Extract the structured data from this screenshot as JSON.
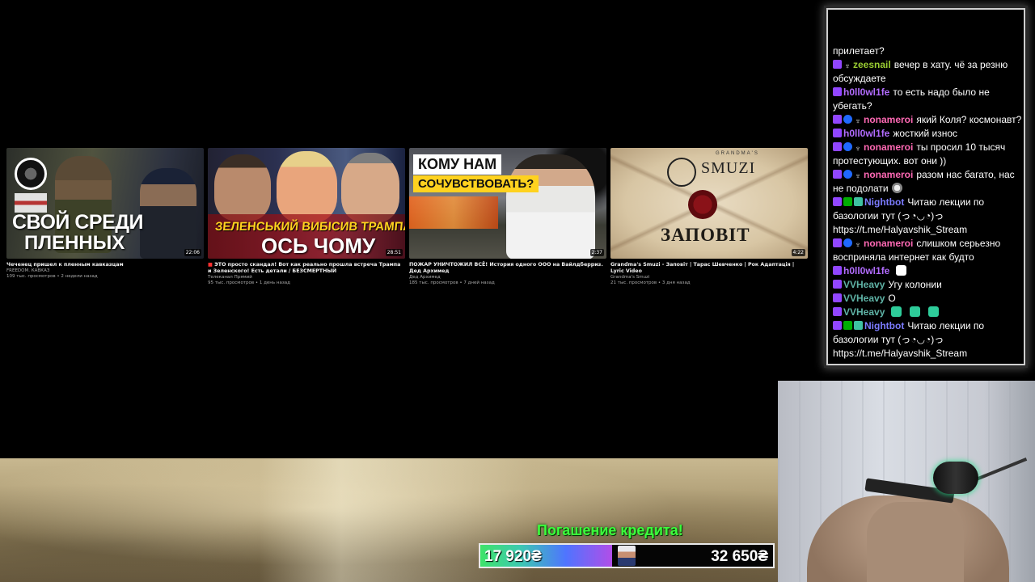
{
  "videos": [
    {
      "thumb_title_line1": "СВОЙ СРЕДИ",
      "thumb_title_line2": "ПЛЕННЫХ",
      "duration": "22:06",
      "title": "Чеченец пришел к пленным кавказцам",
      "channel": "FREEDOM. КАВКАЗ",
      "meta": "109 тыс. просмотров • 2 недели назад"
    },
    {
      "thumb_title_line1": "ЗЕЛЕНСЬКИЙ ВИБІСИВ ТРАМПА!",
      "thumb_title_line2": "ОСЬ ЧОМУ",
      "duration": "28:51",
      "live_marker": "■",
      "title": "ЭТО просто скандал! Вот как реально прошла встреча Трампа и Зеленского! Есть детали / БЕЗСМЕРТНЫЙ",
      "channel": "Телеканал Прямий",
      "meta": "95 тыс. просмотров • 1 день назад"
    },
    {
      "thumb_title_line1": "КОМУ НАМ",
      "thumb_title_line2": "СОЧУВСТВОВАТЬ?",
      "duration": "2:37",
      "title": "ПОЖАР УНИЧТОЖИЛ ВСЁ! История одного ООО на Вайлдберриз. Дед Архимед",
      "channel": "Дед Архимед",
      "meta": "185 тыс. просмотров • 7 дней назад"
    },
    {
      "thumb_brand_small": "GRANDMA'S",
      "thumb_brand": "SMUZI",
      "thumb_title": "ЗАПОВІТ",
      "duration": "4:22",
      "title": "Grandma's Smuzi - Заповіт | Тарас Шевченко | Рок Адаптація | Lyric Video",
      "channel": "Grandma's Smuzi",
      "meta": "21 тыс. просмотров • 3 дня назад"
    }
  ],
  "credit": {
    "title": "Погашение кредита!",
    "current": "17 920₴",
    "goal": "32 650₴",
    "progress_fraction": 0.45,
    "fill_gradient": [
      "#3fe36a",
      "#3cc9b0",
      "#4f74ff",
      "#b14ee8"
    ],
    "title_color": "#3cff3c"
  },
  "chat": {
    "messages": [
      {
        "badges": [],
        "user": "",
        "user_color": "#ffffff",
        "text": "прилетает?"
      },
      {
        "badges": [
          "b-sub",
          "b-horn"
        ],
        "user": "zeesnail",
        "user_color": "#9acd32",
        "text": "вечер в хату. чё за резню обсуждаете"
      },
      {
        "badges": [
          "b-sub"
        ],
        "user": "h0ll0wl1fe",
        "user_color": "#b26cff",
        "text": "то есть надо было не убегать?"
      },
      {
        "badges": [
          "b-sub",
          "b-blue",
          "b-horn"
        ],
        "user": "nonameroi",
        "user_color": "#ff69b4",
        "text": "який Коля? космонавт?"
      },
      {
        "badges": [
          "b-sub"
        ],
        "user": "h0ll0wl1fe",
        "user_color": "#b26cff",
        "text": "жосткий износ"
      },
      {
        "badges": [
          "b-sub",
          "b-blue",
          "b-horn"
        ],
        "user": "nonameroi",
        "user_color": "#ff69b4",
        "text": "ты просил 10 тысяч протестующих. вот они ))"
      },
      {
        "badges": [
          "b-sub",
          "b-blue",
          "b-horn"
        ],
        "user": "nonameroi",
        "user_color": "#ff69b4",
        "text": "разом нас багато, нас не подолати",
        "emote": "em-face"
      },
      {
        "badges": [
          "b-sub",
          "b-green",
          "b-bot"
        ],
        "user": "Nightbot",
        "user_color": "#7c7cff",
        "text": "Читаю лекции по базологии тут (っ◔◡◔)っ https://t.me/Halyavshik_Stream"
      },
      {
        "badges": [
          "b-sub",
          "b-blue",
          "b-horn"
        ],
        "user": "nonameroi",
        "user_color": "#ff69b4",
        "text": "слишком серьезно восприняла интернет как будто"
      },
      {
        "badges": [
          "b-sub"
        ],
        "user": "h0ll0wl1fe",
        "user_color": "#b26cff",
        "text": "",
        "emote": "em-ghost"
      },
      {
        "badges": [
          "b-sub"
        ],
        "user": "VVHeavy",
        "user_color": "#5fb3a6",
        "text": "Угу колонии"
      },
      {
        "badges": [
          "b-sub"
        ],
        "user": "VVHeavy",
        "user_color": "#5fb3a6",
        "text": "О"
      },
      {
        "badges": [
          "b-sub"
        ],
        "user": "VVHeavy",
        "user_color": "#5fb3a6",
        "text": "",
        "emote_count": 3,
        "emote": "em-green"
      },
      {
        "badges": [
          "b-sub",
          "b-green",
          "b-bot"
        ],
        "user": "Nightbot",
        "user_color": "#7c7cff",
        "text": "Читаю лекции по базологии тут (っ◔◡◔)っ https://t.me/Halyavshik_Stream"
      }
    ]
  }
}
